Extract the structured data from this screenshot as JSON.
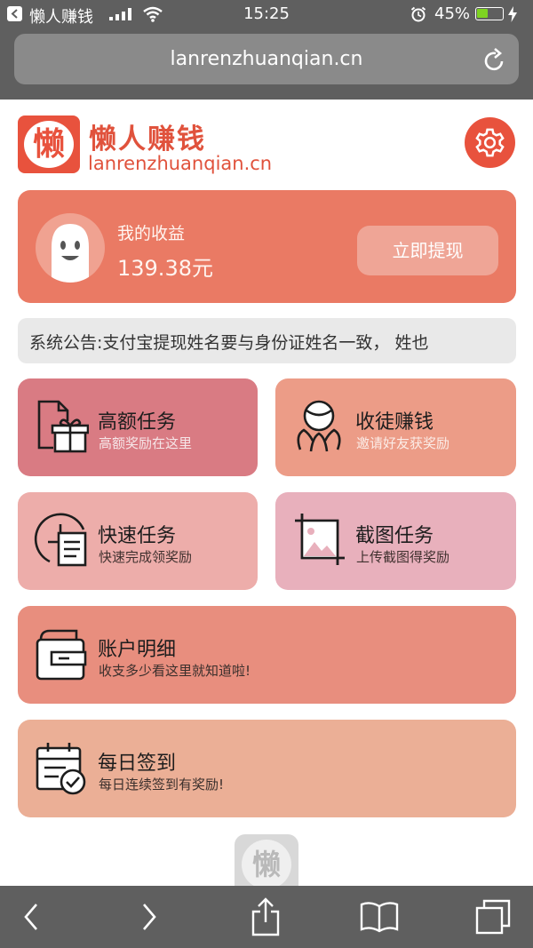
{
  "status_bar": {
    "back_app": "懒人赚钱",
    "time": "15:25",
    "battery_percent": "45%",
    "battery_level": 0.45
  },
  "browser": {
    "url": "lanrenzhuanqian.cn"
  },
  "header": {
    "logo_char": "懒",
    "brand_cn": "懒人赚钱",
    "brand_en": "lanrenzhuanqian.cn"
  },
  "earnings": {
    "label": "我的收益",
    "value": "139.38元",
    "withdraw_label": "立即提现"
  },
  "notice": {
    "text": "系统公告:支付宝提现姓名要与身份证姓名一致， 姓也"
  },
  "tiles": [
    {
      "title": "高额任务",
      "subtitle": "高额奖励在这里",
      "icon": "document-gift-icon"
    },
    {
      "title": "收徒赚钱",
      "subtitle": "邀请好友获奖励",
      "icon": "people-icon"
    },
    {
      "title": "快速任务",
      "subtitle": "快速完成领奖励",
      "icon": "clock-document-icon"
    },
    {
      "title": "截图任务",
      "subtitle": "上传截图得奖励",
      "icon": "image-crop-icon"
    },
    {
      "title": "账户明细",
      "subtitle": "收支多少看这里就知道啦!",
      "icon": "wallet-icon"
    },
    {
      "title": "每日签到",
      "subtitle": "每日连续签到有奖励!",
      "icon": "calendar-check-icon"
    }
  ],
  "bottom_logo_char": "懒",
  "colors": {
    "brand": "#e8523d",
    "earn_card": "#ea7a64",
    "chrome": "#5f5f5f"
  }
}
